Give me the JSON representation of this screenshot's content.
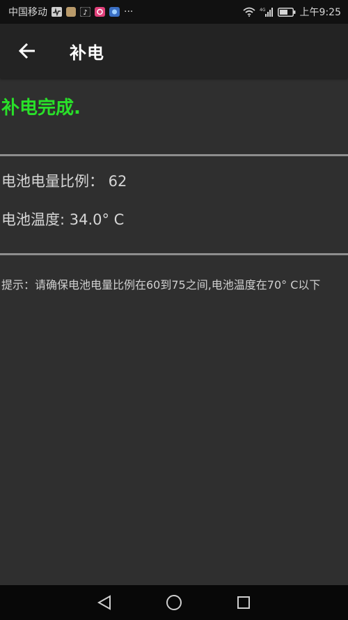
{
  "status_bar": {
    "carrier": "中国移动",
    "overflow": "···",
    "network": "4G",
    "time": "上午9:25"
  },
  "app_bar": {
    "title": "补电"
  },
  "main": {
    "status_message": "补电完成.",
    "battery_level_line": "电池电量比例： 62",
    "battery_temp_line": "电池温度: 34.0° C",
    "tip": "提示：请确保电池电量比例在60到75之间,电池温度在70° C以下"
  },
  "colors": {
    "success": "#29e029",
    "background": "#2f2f2f",
    "toolbar": "#232323"
  },
  "nav_bar": {
    "buttons": [
      "back-triangle-icon",
      "home-circle-icon",
      "recents-square-icon"
    ]
  }
}
